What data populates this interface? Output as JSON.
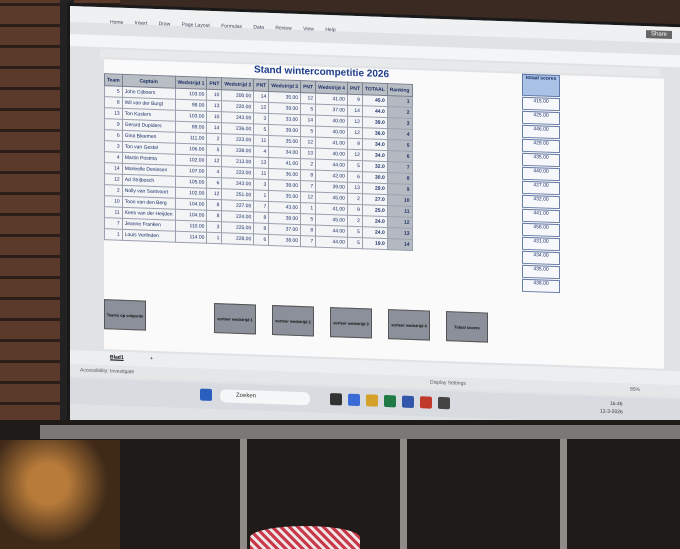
{
  "toolbar": {
    "menu": [
      "Home",
      "Insert",
      "Draw",
      "Page Layout",
      "Formulas",
      "Data",
      "Review",
      "View",
      "Help"
    ],
    "share_label": "Share"
  },
  "sheet": {
    "title": "Stand  wintercompetitie  2026",
    "headers": [
      "Team",
      "Captain",
      "Wedstrijd 1",
      "PNT",
      "Wedstrijd 2",
      "PNT",
      "Wedstrijd 3",
      "PNT",
      "Wedstrijd 4",
      "PNT",
      "TOTAAL",
      "Ranking"
    ],
    "rows": [
      [
        "5",
        "John Cijboers",
        "103.00",
        "10",
        "200.00",
        "14",
        "35.00",
        "12",
        "41.00",
        "9",
        "45.0",
        "1"
      ],
      [
        "8",
        "Wil van der Burgt",
        "98.00",
        "13",
        "220.00",
        "12",
        "39.00",
        "5",
        "37.00",
        "14",
        "44.0",
        "2"
      ],
      [
        "13",
        "Ton Kusters",
        "103.00",
        "10",
        "243.00",
        "3",
        "33.00",
        "14",
        "40.00",
        "12",
        "39.0",
        "3"
      ],
      [
        "9",
        "Gerard Dupiders",
        "89.00",
        "14",
        "236.00",
        "5",
        "39.00",
        "5",
        "40.00",
        "12",
        "36.0",
        "4"
      ],
      [
        "6",
        "Gina Bleemen",
        "111.00",
        "2",
        "223.00",
        "11",
        "35.00",
        "12",
        "41.00",
        "9",
        "34.0",
        "5"
      ],
      [
        "3",
        "Ton van Gestel",
        "106.00",
        "5",
        "238.00",
        "4",
        "34.00",
        "13",
        "40.00",
        "12",
        "34.0",
        "6"
      ],
      [
        "4",
        "Martin Postma",
        "102.00",
        "12",
        "213.00",
        "13",
        "41.00",
        "2",
        "44.00",
        "5",
        "32.0",
        "7"
      ],
      [
        "14",
        "Marieelle Denissen",
        "107.00",
        "4",
        "223.00",
        "11",
        "36.00",
        "8",
        "42.00",
        "6",
        "30.0",
        "8"
      ],
      [
        "12",
        "Ad Strijbosch",
        "105.00",
        "6",
        "243.00",
        "3",
        "38.00",
        "7",
        "39.00",
        "13",
        "29.0",
        "9"
      ],
      [
        "2",
        "Nolly van Santvoort",
        "102.00",
        "12",
        "251.00",
        "1",
        "35.00",
        "12",
        "45.00",
        "2",
        "27.0",
        "10"
      ],
      [
        "10",
        "Toon van den Berg",
        "104.00",
        "8",
        "227.00",
        "7",
        "43.00",
        "1",
        "41.00",
        "9",
        "25.0",
        "11"
      ],
      [
        "11",
        "Kees van der Heijden",
        "104.00",
        "8",
        "224.00",
        "8",
        "38.00",
        "5",
        "45.00",
        "2",
        "24.0",
        "12"
      ],
      [
        "7",
        "Jeanne Franken",
        "110.00",
        "3",
        "225.00",
        "8",
        "37.00",
        "8",
        "44.00",
        "5",
        "24.0",
        "13"
      ],
      [
        "1",
        "Louis Verlinden",
        "114.00",
        "1",
        "228.00",
        "6",
        "38.00",
        "7",
        "44.00",
        "5",
        "19.0",
        "14"
      ]
    ],
    "score_header": "totaal scores",
    "scores": [
      "415.00",
      "425.00",
      "446.00",
      "429.00",
      "435.00",
      "440.00",
      "427.00",
      "432.00",
      "441.00",
      "458.00",
      "431.00",
      "434.00",
      "435.00",
      "438.00"
    ],
    "buttons": [
      "Teams op volgorde",
      "sorteer wedstrijd 1",
      "sorteer wedstrijd 2",
      "sorteer wedstrijd 3",
      "sorteer wedstrijd 4",
      "Totaal scores"
    ]
  },
  "tabs": {
    "active": "Blad1",
    "add": "+"
  },
  "status": {
    "left": "Accessibility: Investigate",
    "display": "Display Settings",
    "zoom": "85%"
  },
  "taskbar": {
    "search_placeholder": "Zoeken",
    "time": "16:46",
    "date": "12-3-2026"
  },
  "colors": {
    "header": "#b9bdc4",
    "score_header": "#a9c2e6",
    "title": "#1d3d8a"
  }
}
